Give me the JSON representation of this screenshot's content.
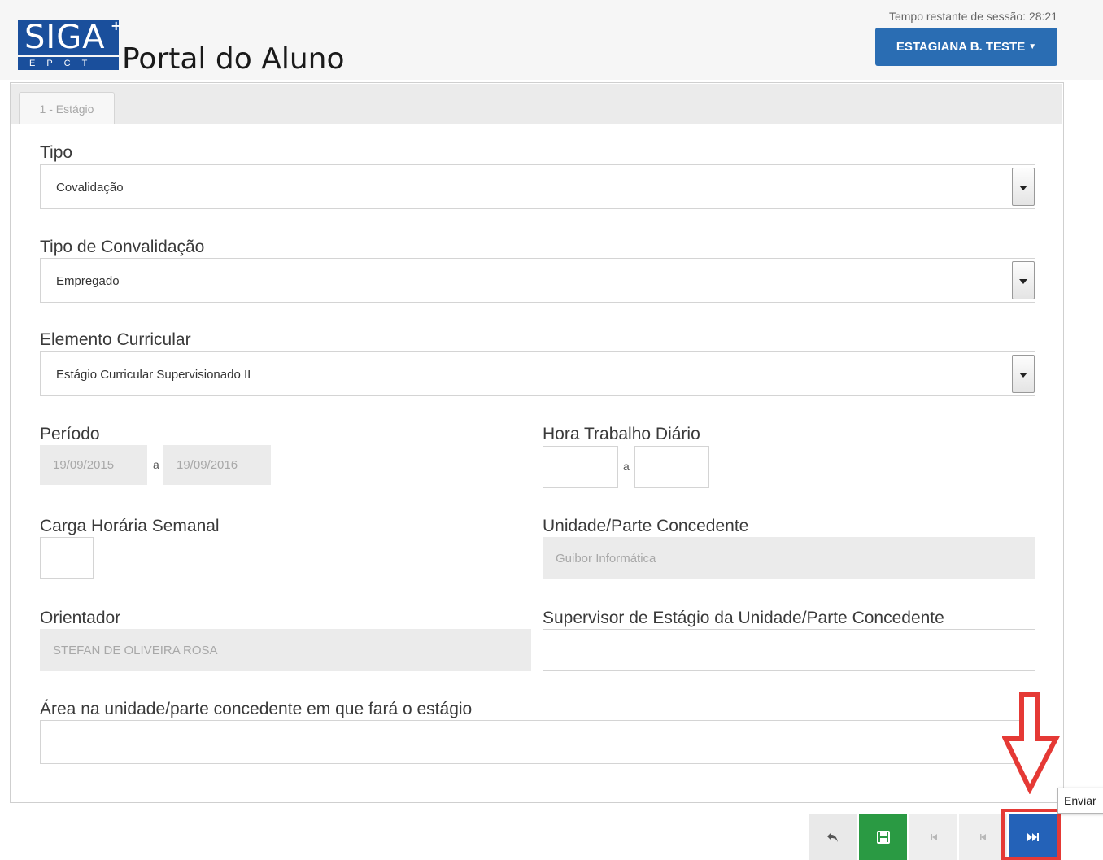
{
  "header": {
    "logo_text": "SIGA",
    "logo_plus": "+",
    "logo_sub": "EPCT",
    "title": "Portal do Aluno",
    "session_text": "Tempo restante de sessão: 28:21",
    "user_button": "ESTAGIANA B. TESTE"
  },
  "tabs": [
    {
      "label": "1 - Estágio",
      "active": true
    }
  ],
  "form": {
    "tipo": {
      "label": "Tipo",
      "value": "Covalidação"
    },
    "tipo_convalidacao": {
      "label": "Tipo de Convalidação",
      "value": "Empregado"
    },
    "elemento_curricular": {
      "label": "Elemento Curricular",
      "value": "Estágio Curricular Supervisionado II"
    },
    "periodo": {
      "label": "Período",
      "from": "19/09/2015",
      "separator": "a",
      "to": "19/09/2016"
    },
    "hora_trabalho": {
      "label": "Hora Trabalho Diário",
      "from": "",
      "separator": "a",
      "to": ""
    },
    "carga_horaria": {
      "label": "Carga Horária Semanal",
      "value": ""
    },
    "unidade_concedente": {
      "label": "Unidade/Parte Concedente",
      "value": "Guibor Informática"
    },
    "orientador": {
      "label": "Orientador",
      "value": "STEFAN DE OLIVEIRA ROSA"
    },
    "supervisor": {
      "label": "Supervisor de Estágio da Unidade/Parte Concedente",
      "value": ""
    },
    "area": {
      "label": "Área na unidade/parte concedente em que fará o estágio",
      "value": ""
    }
  },
  "toolbar": {
    "buttons": [
      {
        "name": "back",
        "icon": "undo-icon",
        "color": "#e9e9e9"
      },
      {
        "name": "save",
        "icon": "floppy-icon",
        "color": "#2a9a43"
      },
      {
        "name": "first",
        "icon": "first-page-icon",
        "color": "#eeeeee"
      },
      {
        "name": "previous",
        "icon": "previous-icon",
        "color": "#eeeeee"
      },
      {
        "name": "send",
        "icon": "fast-forward-icon",
        "color": "#2462b8"
      }
    ],
    "tooltip": "Enviar"
  },
  "colors": {
    "brand": "#1a4f9c",
    "user_button": "#2a6db3",
    "highlight": "#e53935"
  }
}
